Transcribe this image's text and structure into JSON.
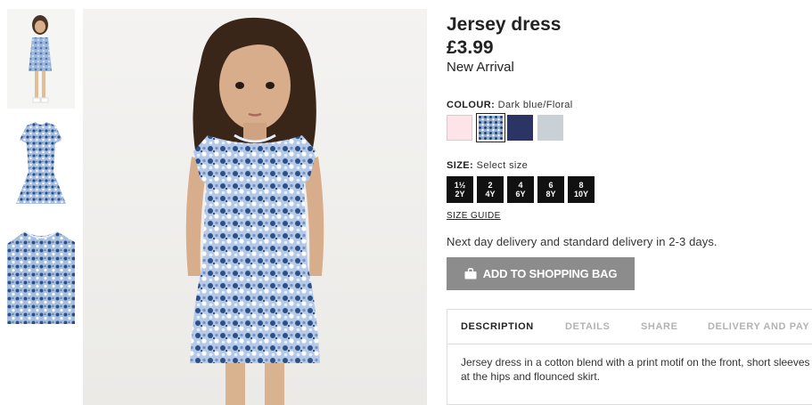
{
  "product": {
    "title": "Jersey dress",
    "price": "£3.99",
    "badge": "New Arrival"
  },
  "colour": {
    "label": "COLOUR:",
    "selected": "Dark blue/Floral",
    "swatches": [
      {
        "name": "light-pink",
        "color": "#fce4e8"
      },
      {
        "name": "dark-blue-floral",
        "color": "#4b6a9a",
        "selected": true
      },
      {
        "name": "dark-blue",
        "color": "#2a3566"
      },
      {
        "name": "light-grey",
        "color": "#c9d1d6"
      }
    ]
  },
  "size": {
    "label": "SIZE:",
    "placeholder": "Select size",
    "options": [
      "1½\n2Y",
      "2\n4Y",
      "4\n6Y",
      "6\n8Y",
      "8\n10Y"
    ]
  },
  "size_guide": "SIZE GUIDE",
  "delivery": "Next day delivery and standard delivery in 2-3 days.",
  "add_to_bag": {
    "label": "ADD TO SHOPPING BAG",
    "icon": "shopping-bag-icon"
  },
  "tabs": [
    "DESCRIPTION",
    "DETAILS",
    "SHARE",
    "DELIVERY AND PAY"
  ],
  "description": {
    "line1": "Jersey dress in a cotton blend with a print motif on the front, short sleeves",
    "line2": "at the hips and flounced skirt."
  },
  "colors": {
    "dress": "#9db8de",
    "dress_dark": "#2c4f86",
    "button": "#8c8c8c",
    "size_bg": "#111111"
  }
}
